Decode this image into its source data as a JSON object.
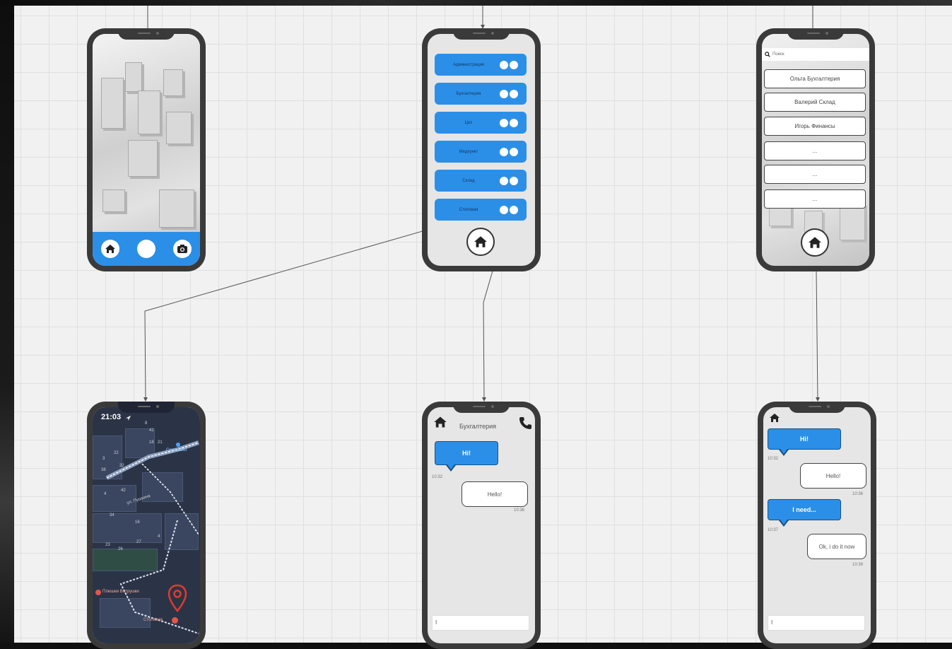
{
  "city_screen": {
    "icons": [
      "home-icon",
      "capture-circle",
      "camera-icon"
    ]
  },
  "menu_screen": {
    "items": [
      {
        "label": "Администрация"
      },
      {
        "label": "Бухгалтерия"
      },
      {
        "label": "Цех"
      },
      {
        "label": "Медпункт"
      },
      {
        "label": "Склад"
      },
      {
        "label": "Столовая"
      }
    ]
  },
  "contacts_screen": {
    "search_placeholder": "Поиск",
    "contacts": [
      {
        "label": "Ольга Бухгалтерия"
      },
      {
        "label": "Валерий Склад"
      },
      {
        "label": "Игорь Финансы"
      },
      {
        "label": "..."
      },
      {
        "label": "..."
      },
      {
        "label": "..."
      }
    ]
  },
  "map_screen": {
    "time": "21:03",
    "poi_top": "Солнышко",
    "street": "ул. Пушкина",
    "poi_left": "Плюшки Ватрушки",
    "poi_dest": "Столовая",
    "numbers": [
      "41",
      "8",
      "18",
      "21",
      "22",
      "3",
      "32",
      "38",
      "42",
      "4",
      "26",
      "27",
      "23",
      "4",
      "16",
      "34"
    ]
  },
  "chat_dept": {
    "title": "Бухгалтерия",
    "messages": [
      {
        "text": "Hi!",
        "time": "10:32",
        "side": "left"
      },
      {
        "text": "Hello!",
        "time": "10:36",
        "side": "right"
      }
    ],
    "input": "I"
  },
  "chat_person": {
    "messages": [
      {
        "text": "Hi!",
        "time": "10:32",
        "side": "left"
      },
      {
        "text": "Hello!",
        "time": "10:36",
        "side": "right"
      },
      {
        "text": "I need...",
        "time": "10:37",
        "side": "left"
      },
      {
        "text": "Ok, i do it now",
        "time": "10:39",
        "side": "right"
      }
    ],
    "input": "I"
  },
  "colors": {
    "accent": "#2b8fe8",
    "phone_frame": "#3a3a3a",
    "canvas": "#f1f1f1"
  }
}
